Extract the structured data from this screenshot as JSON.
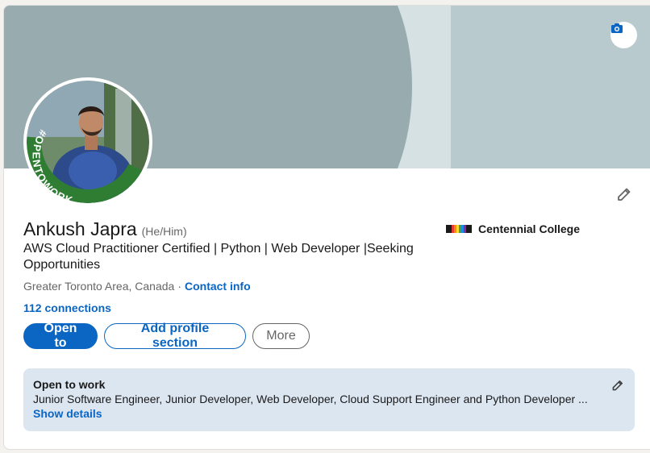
{
  "profile": {
    "name": "Ankush Japra",
    "pronouns": "(He/Him)",
    "headline": "AWS Cloud Practitioner Certified | Python | Web Developer |Seeking Opportunities",
    "location": "Greater Toronto Area, Canada",
    "separator": "·",
    "contact_info_label": "Contact info",
    "connections_label": "112 connections",
    "avatar_frame_text": "#OPENTOWORK"
  },
  "education": {
    "school_name": "Centennial College"
  },
  "actions": {
    "open_to_label": "Open to",
    "add_section_label": "Add profile section",
    "more_label": "More"
  },
  "open_to_work": {
    "title": "Open to work",
    "description": "Junior Software Engineer, Junior Developer, Web Developer, Cloud Support Engineer and Python Developer ...",
    "show_details_label": "Show details"
  },
  "icons": {
    "camera": "camera-icon",
    "edit": "pencil-icon"
  },
  "colors": {
    "accent": "#0a66c2",
    "open_to_work_green": "#2e7d32",
    "open_to_work_bg": "#dce6f1",
    "banner_dark": "#98abae",
    "banner_light": "#b8cace"
  }
}
